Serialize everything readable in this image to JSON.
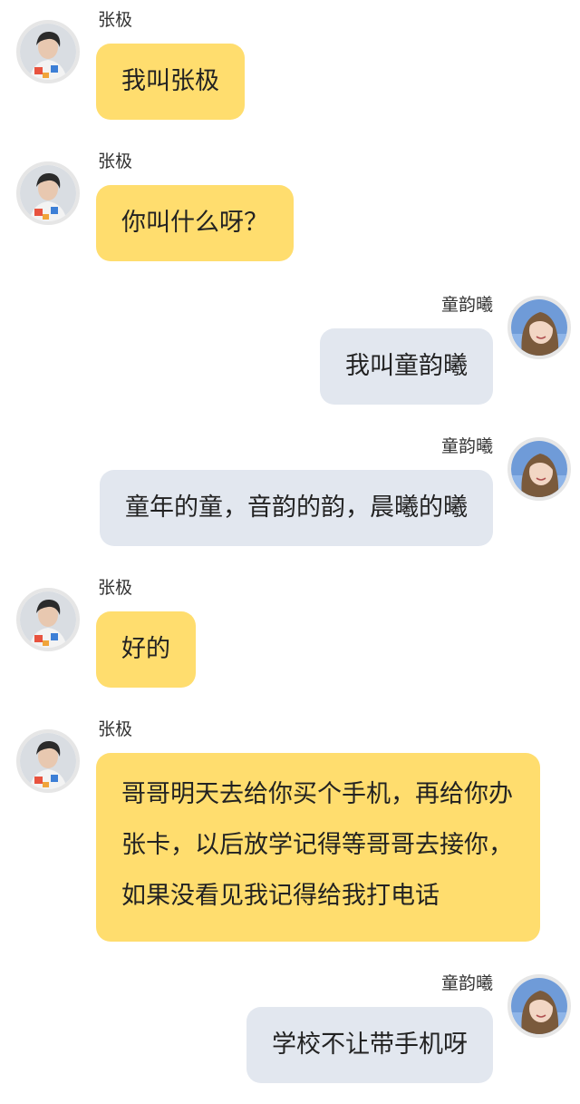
{
  "users": {
    "left": {
      "name": "张极",
      "avatar_icon": "avatar-boy-icon"
    },
    "right": {
      "name": "童韵曦",
      "avatar_icon": "avatar-girl-icon"
    }
  },
  "messages": [
    {
      "side": "left",
      "name": "张极",
      "text": "我叫张极"
    },
    {
      "side": "left",
      "name": "张极",
      "text": "你叫什么呀？"
    },
    {
      "side": "right",
      "name": "童韵曦",
      "text": "我叫童韵曦"
    },
    {
      "side": "right",
      "name": "童韵曦",
      "text": "童年的童，音韵的韵，晨曦的曦"
    },
    {
      "side": "left",
      "name": "张极",
      "text": "好的"
    },
    {
      "side": "left",
      "name": "张极",
      "lines": [
        "哥哥明天去给你买个手机，再给你办",
        "张卡，以后放学记得等哥哥去接你，",
        "如果没看见我记得给我打电话"
      ]
    },
    {
      "side": "right",
      "name": "童韵曦",
      "text": "学校不让带手机呀"
    }
  ],
  "colors": {
    "left_bubble": "#ffdd6e",
    "right_bubble": "#e2e7ef",
    "background": "#ffffff"
  }
}
